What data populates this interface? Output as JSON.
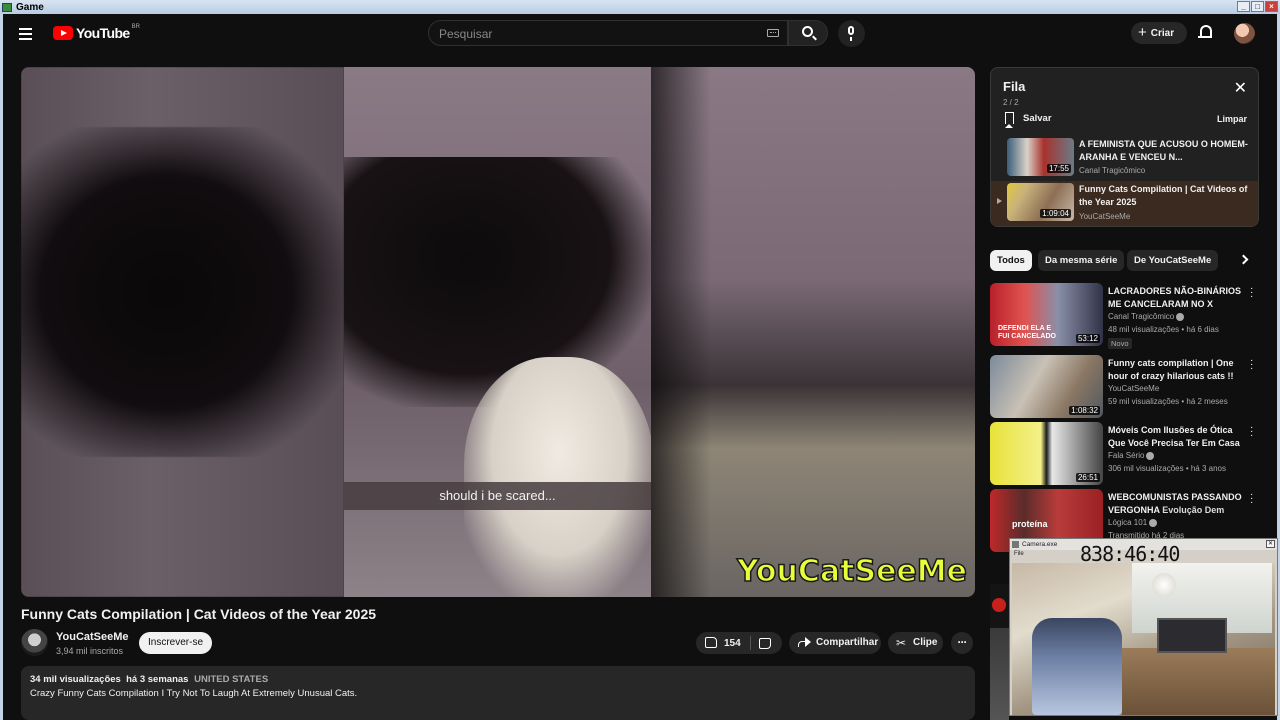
{
  "window": {
    "title": "Game"
  },
  "header": {
    "logo_text": "YouTube",
    "logo_country": "BR",
    "search_placeholder": "Pesquisar",
    "create_label": "Criar"
  },
  "player": {
    "caption": "should i be scared...",
    "watermark": "YouCatSeeMe"
  },
  "video": {
    "title": "Funny Cats Compilation | Cat Videos of the Year 2025",
    "channel": "YouCatSeeMe",
    "subscribers": "3,94 mil inscritos",
    "subscribe_label": "Inscrever-se",
    "likes": "154",
    "share_label": "Compartilhar",
    "clip_label": "Clipe",
    "views": "34 mil visualizações",
    "age": "há 3 semanas",
    "location": "UNITED STATES",
    "description": "Crazy Funny Cats Compilation I Try Not To Laugh At Extremely Unusual Cats."
  },
  "queue": {
    "title": "Fila",
    "count": "2 / 2",
    "save_label": "Salvar",
    "clear_label": "Limpar",
    "items": [
      {
        "title": "A FEMINISTA QUE ACUSOU O HOMEM-ARANHA E VENCEU N...",
        "channel": "Canal Tragicômico",
        "duration": "17:55"
      },
      {
        "title": "Funny Cats Compilation | Cat Videos of the Year 2025",
        "channel": "YouCatSeeMe",
        "duration": "1:09:04"
      }
    ]
  },
  "chips": [
    "Todos",
    "Da mesma série",
    "De YouCatSeeMe"
  ],
  "recommendations": [
    {
      "title": "LACRADORES NÃO-BINÁRIOS ME CANCELARAM NO X",
      "channel": "Canal Tragicômico",
      "meta": "48 mil visualizações • há 6 dias",
      "badge": "Novo",
      "duration": "53:12",
      "thumb_text": "DEFENDI ELA E FUI CANCELADO"
    },
    {
      "title": "Funny cats compilation | One hour of crazy hilarious cats !!",
      "channel": "YouCatSeeMe",
      "meta": "59 mil visualizações • há 2 meses",
      "duration": "1:08:32"
    },
    {
      "title": "Móveis Com Ilusões de Ótica Que Você Precisa Ter Em Casa",
      "channel": "Fala Sério",
      "meta": "306 mil visualizações • há 3 anos",
      "duration": "26:51"
    },
    {
      "title": "WEBCOMUNISTAS PASSANDO VERGONHA",
      "overlap_title": "Evolução Dem",
      "channel": "Lógica 101",
      "meta": "Transmitido há 2 dias",
      "thumb_text": "proteína"
    }
  ],
  "overlay": {
    "title": "Camera.exe",
    "menu": "File",
    "timer": "838:46:40"
  },
  "colors": {
    "accent": "#ff0000",
    "background": "#0f0f0f",
    "watermark": "#e6ff3a"
  }
}
